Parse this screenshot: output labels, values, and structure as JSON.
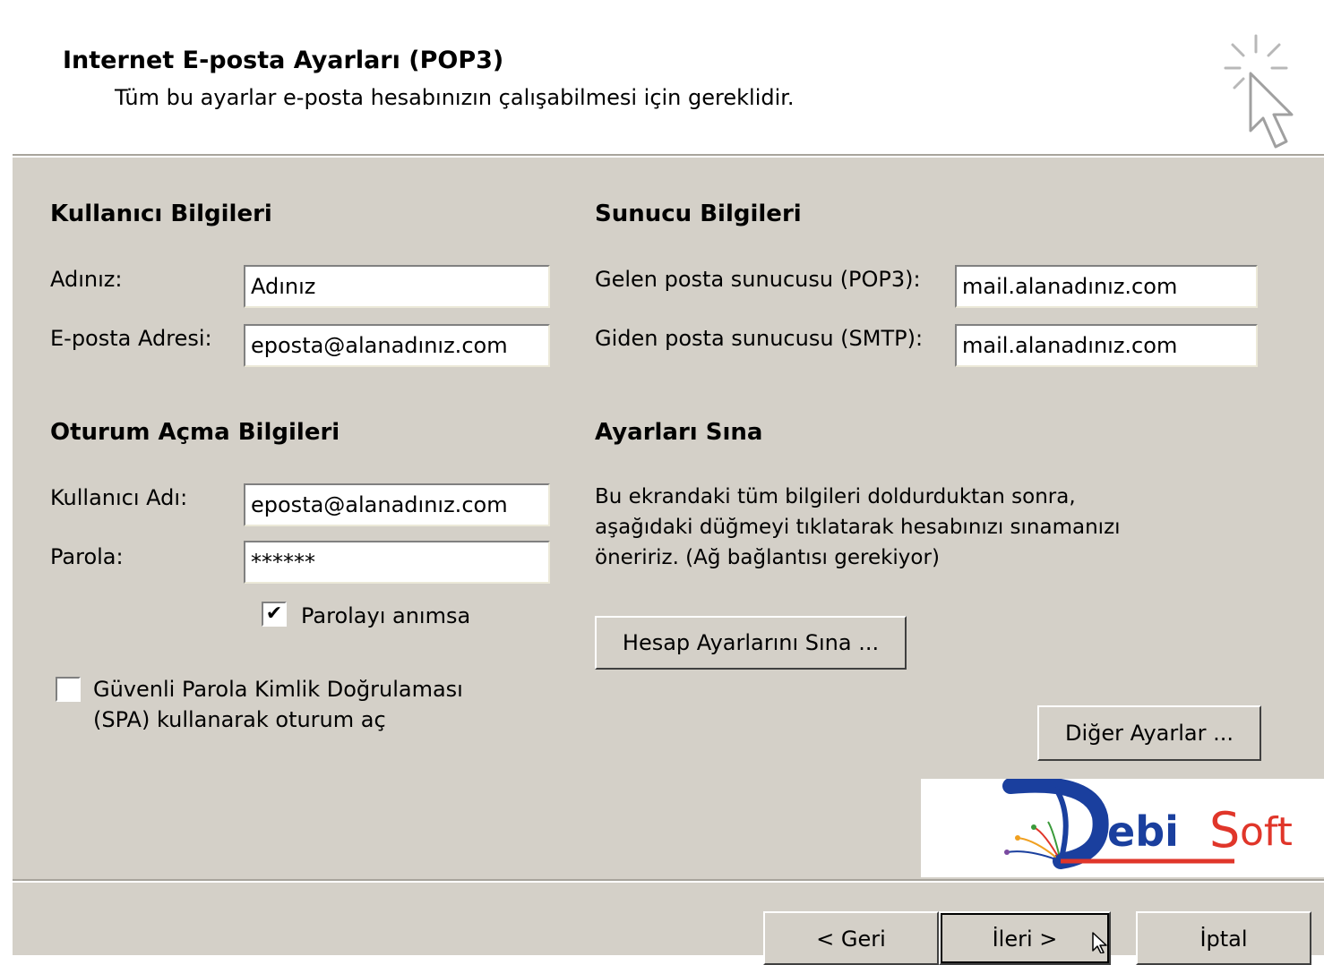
{
  "header": {
    "title": "Internet E-posta Ayarları (POP3)",
    "subtitle": "Tüm bu ayarlar e-posta hesabınızın çalışabilmesi için gereklidir.",
    "icon": "wizard-cursor-icon"
  },
  "user_info": {
    "title": "Kullanıcı Bilgileri",
    "name_label": "Adınız:",
    "name_value": "Adınız",
    "email_label": "E-posta Adresi:",
    "email_value": "eposta@alanadınız.com"
  },
  "server_info": {
    "title": "Sunucu Bilgileri",
    "incoming_label": "Gelen posta sunucusu (POP3):",
    "incoming_value": "mail.alanadınız.com",
    "outgoing_label": "Giden posta sunucusu (SMTP):",
    "outgoing_value": "mail.alanadınız.com"
  },
  "logon_info": {
    "title": "Oturum Açma Bilgileri",
    "username_label": "Kullanıcı Adı:",
    "username_value": "eposta@alanadınız.com",
    "password_label": "Parola:",
    "password_value": "******",
    "remember_label": "Parolayı anımsa",
    "remember_checked": true,
    "spa_label_line1": "Güvenli Parola Kimlik Doğrulaması",
    "spa_label_line2": "(SPA) kullanarak oturum aç",
    "spa_checked": false
  },
  "test_settings": {
    "title": "Ayarları Sına",
    "desc_line1": "Bu ekrandaki tüm bilgileri doldurduktan sonra,",
    "desc_line2": "aşağıdaki düğmeyi tıklatarak hesabınızı sınamanızı",
    "desc_line3": "öneririz. (Ağ bağlantısı gerekiyor)",
    "test_button": "Hesap Ayarlarını Sına ..."
  },
  "more_settings_button": "Diğer Ayarlar ...",
  "logo": {
    "text_e": "ebi",
    "text_s": "S",
    "text_oft": "oft",
    "colors": {
      "blue": "#1a3f9e",
      "red": "#e0362a",
      "orange": "#f0a020"
    }
  },
  "footer": {
    "back_button": "< Geri",
    "next_button": "İleri >",
    "cancel_button": "İptal"
  },
  "colors": {
    "dialog_bg": "#d4d0c8"
  }
}
